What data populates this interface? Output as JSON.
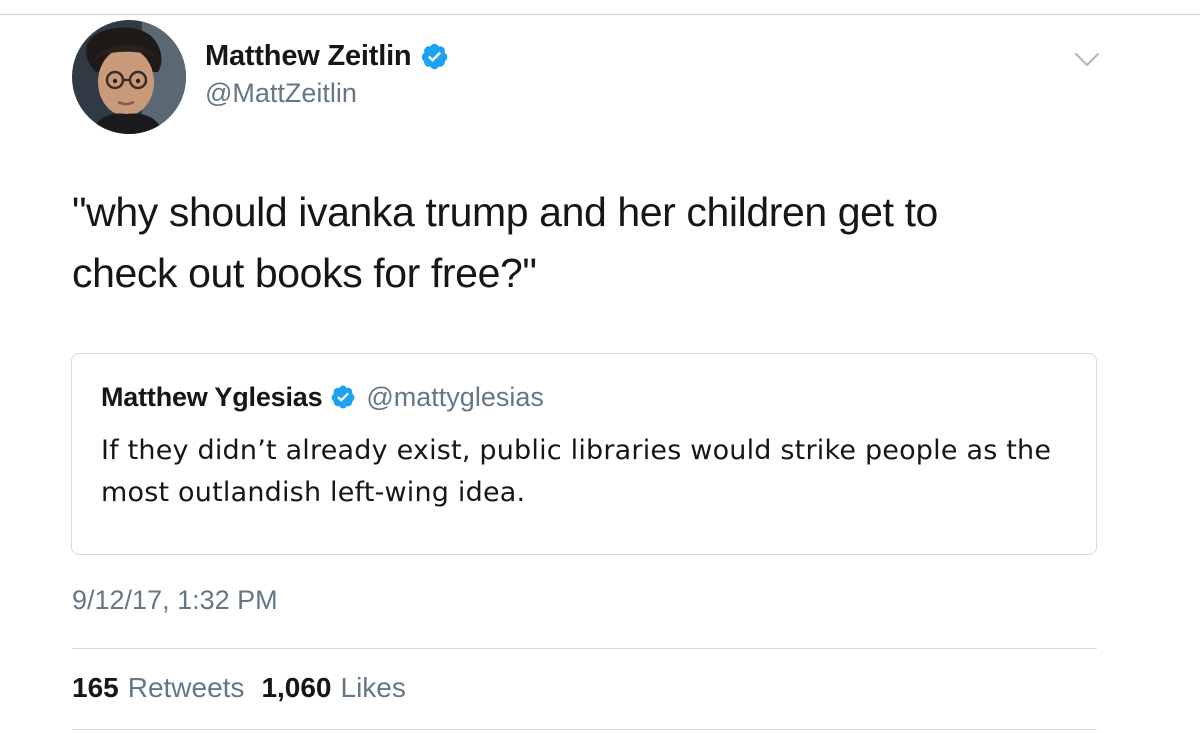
{
  "author": {
    "display_name": "Matthew Zeitlin",
    "handle": "@MattZeitlin",
    "verified": true,
    "avatar_icon": "profile-photo"
  },
  "tweet": {
    "text": "\"why should ivanka trump and her children get to\ncheck out books for free?\""
  },
  "quoted_tweet": {
    "display_name": "Matthew Yglesias",
    "handle": "@mattyglesias",
    "verified": true,
    "text": "If they didn’t already exist, public libraries would strike people as the most outlandish left-wing idea."
  },
  "meta": {
    "timestamp": "9/12/17, 1:32 PM"
  },
  "stats": {
    "retweets_count": "165",
    "retweets_label": "Retweets",
    "likes_count": "1,060",
    "likes_label": "Likes"
  },
  "icons": {
    "verified": "verified-badge-icon",
    "more": "chevron-down-icon"
  },
  "colors": {
    "verified_blue": "#1da1f2",
    "secondary_text": "#657786",
    "primary_text": "#14171a",
    "border": "#d6dce1"
  }
}
